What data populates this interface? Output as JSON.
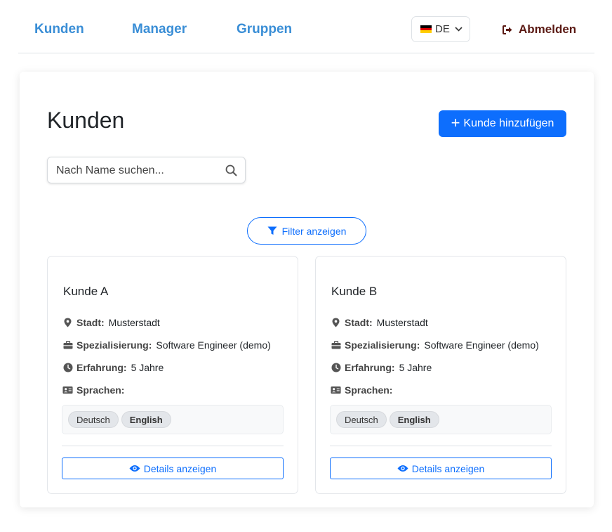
{
  "nav": {
    "links": [
      "Kunden",
      "Manager",
      "Gruppen"
    ],
    "language": "DE",
    "logout_label": "Abmelden"
  },
  "colors": {
    "nav_link": "#3a8ed6",
    "logout": "#5b1a14",
    "primary": "#0d6efd"
  },
  "page": {
    "title": "Kunden",
    "add_button": "Kunde hinzufügen",
    "search_placeholder": "Nach Name suchen...",
    "filter_button": "Filter anzeigen"
  },
  "labels": {
    "city": "Stadt:",
    "specialization": "Spezialisierung:",
    "experience": "Erfahrung:",
    "languages": "Sprachen:",
    "details_button": "Details anzeigen"
  },
  "customers": [
    {
      "name": "Kunde A",
      "city": "Musterstadt",
      "specialization": "Software Engineer (demo)",
      "experience": "5 Jahre",
      "languages": [
        "Deutsch",
        "English"
      ]
    },
    {
      "name": "Kunde B",
      "city": "Musterstadt",
      "specialization": "Software Engineer (demo)",
      "experience": "5 Jahre",
      "languages": [
        "Deutsch",
        "English"
      ]
    }
  ],
  "icons": [
    "flag-de-icon",
    "chevron-down-icon",
    "logout-icon",
    "plus-icon",
    "search-icon",
    "filter-icon",
    "map-marker-icon",
    "briefcase-icon",
    "clock-icon",
    "id-card-icon",
    "eye-icon"
  ]
}
